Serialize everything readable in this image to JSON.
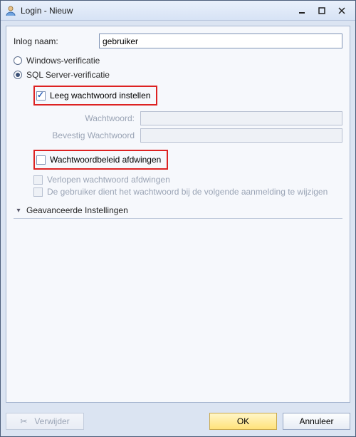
{
  "window": {
    "title": "Login - Nieuw"
  },
  "form": {
    "login_name_label": "Inlog naam:",
    "login_name_value": "gebruiker",
    "auth_windows": "Windows-verificatie",
    "auth_sql": "SQL Server-verificatie",
    "blank_password": "Leeg wachtwoord instellen",
    "password_label": "Wachtwoord:",
    "confirm_password_label": "Bevestig Wachtwoord",
    "enforce_policy": "Wachtwoordbeleid afdwingen",
    "enforce_expiration": "Verlopen wachtwoord afdwingen",
    "must_change": "De gebruiker dient het wachtwoord bij de volgende aanmelding te wijzigen",
    "advanced": "Geavanceerde Instellingen"
  },
  "buttons": {
    "delete": "Verwijder",
    "ok": "OK",
    "cancel": "Annuleer"
  }
}
